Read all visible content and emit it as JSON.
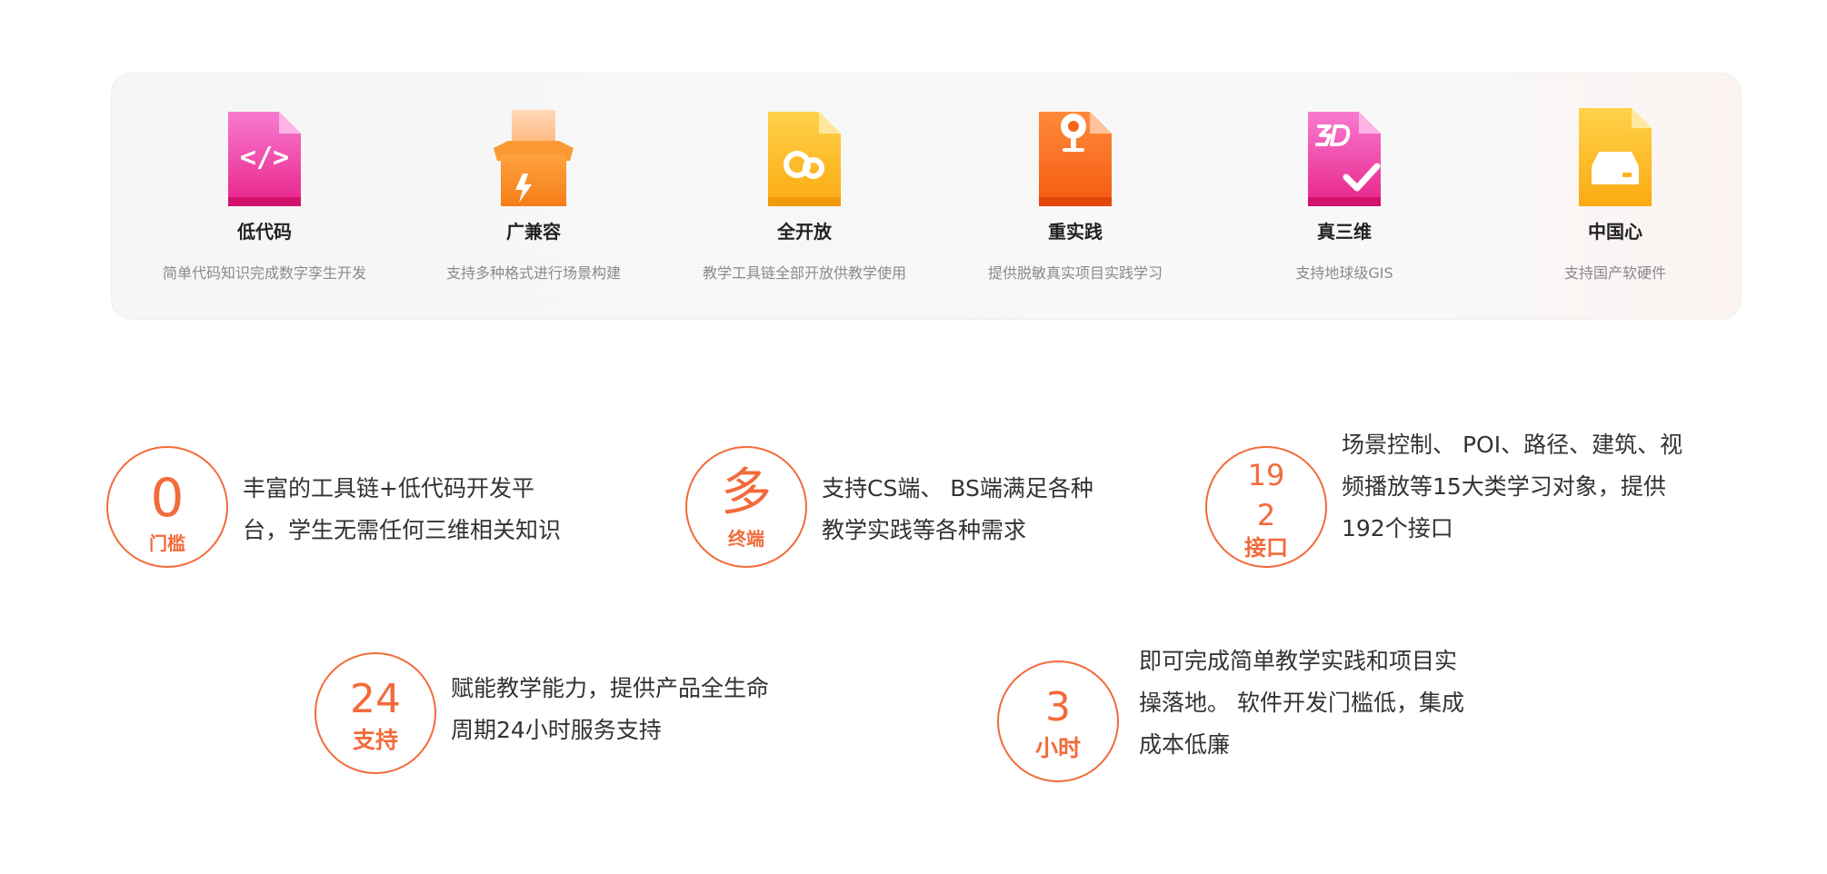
{
  "features": [
    {
      "icon": "code-file-icon",
      "title": "低代码",
      "desc": "简单代码知识完成数字孪生开发",
      "color": "#ec2f8f"
    },
    {
      "icon": "compatibility-box-icon",
      "title": "广兼容",
      "desc": "支持多种格式进行场景构建",
      "color": "#f7892b"
    },
    {
      "icon": "open-link-file-icon",
      "title": "全开放",
      "desc": "教学工具链全部开放供教学使用",
      "color": "#fbb21a"
    },
    {
      "icon": "practice-location-file-icon",
      "title": "重实践",
      "desc": "提供脱敏真实项目实践学习",
      "color": "#fb6a1c"
    },
    {
      "icon": "3d-check-file-icon",
      "title": "真三维",
      "desc": "支持地球级GIS",
      "color": "#ee3d9a"
    },
    {
      "icon": "hardware-drive-icon",
      "title": "中国心",
      "desc": "支持国产软硬件",
      "color": "#fcb41d"
    }
  ],
  "stats": [
    {
      "number": "0",
      "unit": "门槛",
      "lines": [
        "丰富的工具链+低代码开发平",
        "台，学生无需任何三维相关知识"
      ]
    },
    {
      "number": "多",
      "unit": "终端",
      "lines": [
        "支持CS端、 BS端满足各种",
        "教学实践等各种需求"
      ]
    },
    {
      "number_lines": [
        "19",
        "2"
      ],
      "unit": "接口",
      "lines": [
        "场景控制、  POI、路径、建筑、视",
        "频播放等15大类学习对象，提供",
        "192个接口"
      ]
    },
    {
      "number": "24",
      "unit": "支持",
      "lines": [
        "赋能教学能力，提供产品全生命",
        "周期24小时服务支持"
      ]
    },
    {
      "number": "3",
      "unit": "小时",
      "lines": [
        "即可完成简单教学实践和项目实",
        "操落地。 软件开发门槛低，集成",
        "成本低廉"
      ]
    }
  ],
  "accent_color": "#f26b3a"
}
